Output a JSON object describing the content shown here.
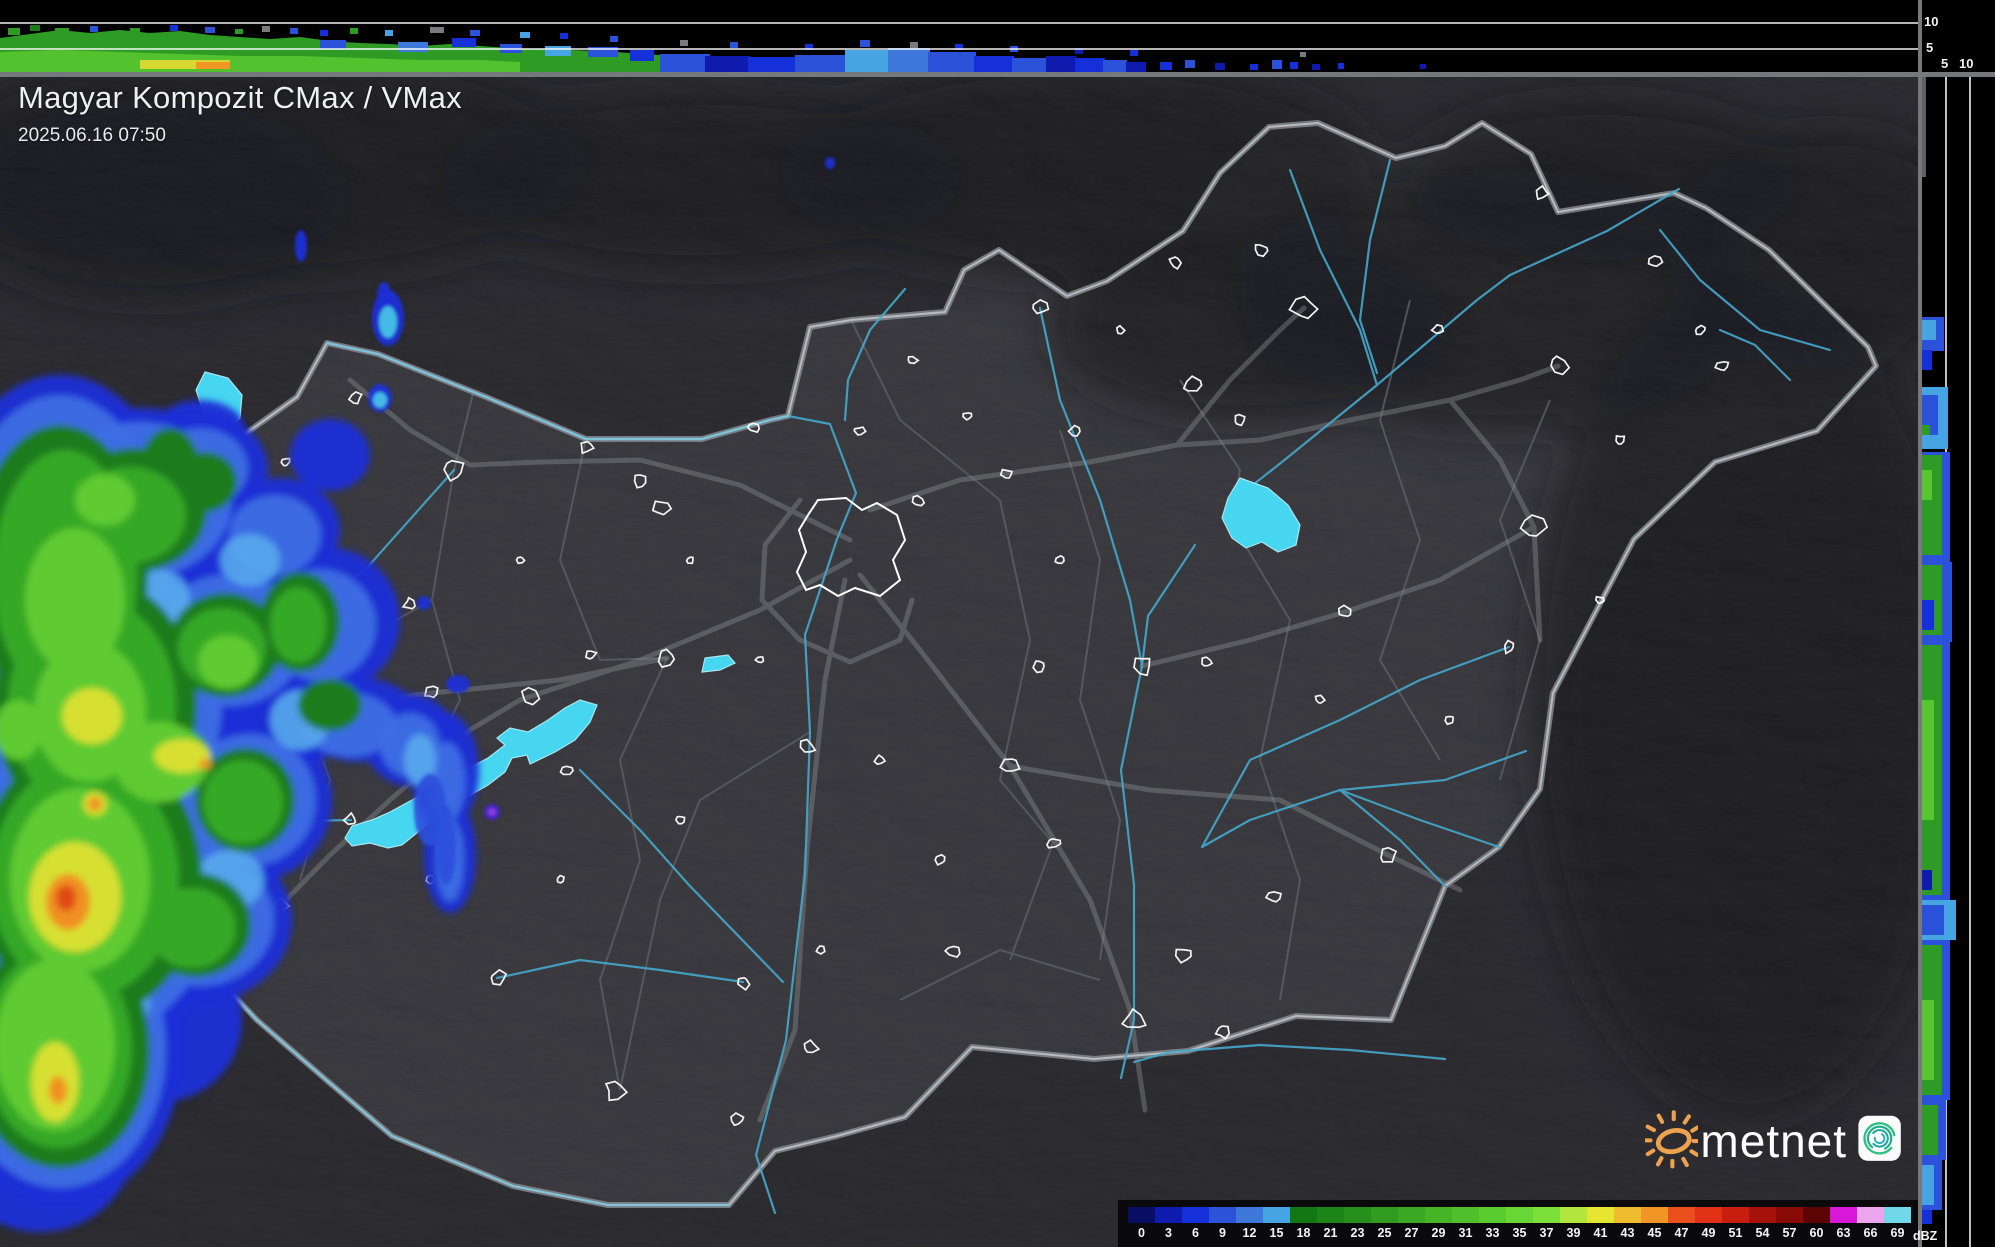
{
  "header": {
    "title": "Magyar Kompozit CMax / VMax",
    "timestamp": "2025.06.16 07:50"
  },
  "axes": {
    "top_strip": {
      "km_label_10": "10",
      "km_label_5": "5"
    },
    "right_strip": {
      "km_label_5": "5",
      "km_label_10": "10"
    }
  },
  "legend": {
    "unit": "dBZ",
    "ticks": [
      "0",
      "3",
      "6",
      "9",
      "12",
      "15",
      "18",
      "21",
      "23",
      "25",
      "27",
      "29",
      "31",
      "33",
      "35",
      "37",
      "39",
      "41",
      "43",
      "45",
      "47",
      "49",
      "51",
      "54",
      "57",
      "60",
      "63",
      "66",
      "69"
    ],
    "colors": [
      "#0a0e64",
      "#0f1aae",
      "#1530d8",
      "#2b52d8",
      "#3e78da",
      "#47a4e2",
      "#137813",
      "#1d8417",
      "#27901b",
      "#319c1f",
      "#3ba823",
      "#45b427",
      "#4fc02b",
      "#59cc2f",
      "#68d634",
      "#7ce03a",
      "#b2e63c",
      "#e6e632",
      "#eebc2e",
      "#f09526",
      "#ea4f1e",
      "#e03016",
      "#c81e10",
      "#a8120c",
      "#8a0a08",
      "#5c0404",
      "#d818d8",
      "#eca4ec",
      "#70d8e8"
    ]
  },
  "branding": {
    "logo_text": "metnet",
    "sun_icon": "sun-icon",
    "app_icon": "metnet-app-icon"
  },
  "colors": {
    "map_bg": "#36363a",
    "outside_bg": "#2b2b2f",
    "strip_bg": "#000000",
    "frame_bar": "#76787b",
    "panel_grid": "#ffffff",
    "lake": "#46d6f0",
    "river": "#46a8cc",
    "country_border": "#9ba0a6",
    "county_border": "#5d6064",
    "road": "#8b8d90",
    "town_outline": "#ffffff"
  }
}
